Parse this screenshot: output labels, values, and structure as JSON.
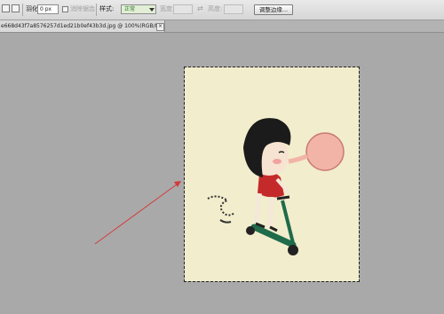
{
  "options_bar": {
    "feather_label": "羽化:",
    "feather_value": "0 px",
    "antialias_label": "消除锯齿",
    "style_label": "样式:",
    "style_value": "正常",
    "width_label": "宽度:",
    "height_label": "高度:",
    "refine_edge_button": "调整边缘..."
  },
  "document_tab": {
    "title": "e668d43f7a8576257d1ed21b0ef43b3d.jpg @ 100%(RGB/8#)",
    "close_symbol": "×"
  },
  "colors": {
    "workspace": "#a9a9a9",
    "canvas": "#f2edcc",
    "arrow": "#d43a3a"
  },
  "icons": [
    "selection-mode-icon",
    "add-selection-icon",
    "swap-icon"
  ]
}
